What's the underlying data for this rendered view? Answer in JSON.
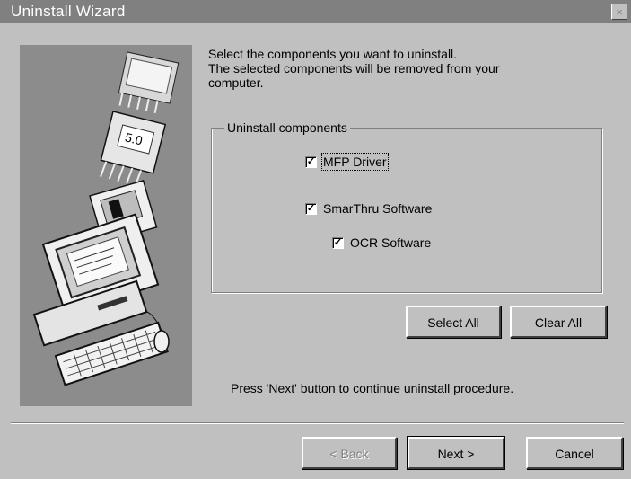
{
  "window": {
    "title": "Uninstall Wizard",
    "close_glyph": "×"
  },
  "intro": {
    "line1": "Select the components you want to uninstall.",
    "line2": "The selected components will be removed from your",
    "line3": "computer."
  },
  "components": {
    "legend": "Uninstall components",
    "items": [
      {
        "label": "MFP Driver",
        "checked": true
      },
      {
        "label": "SmarThru Software",
        "checked": true
      },
      {
        "label": "OCR Software",
        "checked": true
      }
    ]
  },
  "selection_buttons": {
    "select_all": "Select All",
    "clear_all": "Clear All"
  },
  "hint": "Press 'Next' button to continue uninstall procedure.",
  "nav_buttons": {
    "back": "< Back",
    "next": "Next >",
    "cancel": "Cancel"
  },
  "side_image": {
    "icon": "computer-illustration",
    "screen_text": "5.0"
  },
  "colors": {
    "titlebar": "#808080",
    "face": "#c0c0c0",
    "image_bg": "#8c8c8c"
  }
}
